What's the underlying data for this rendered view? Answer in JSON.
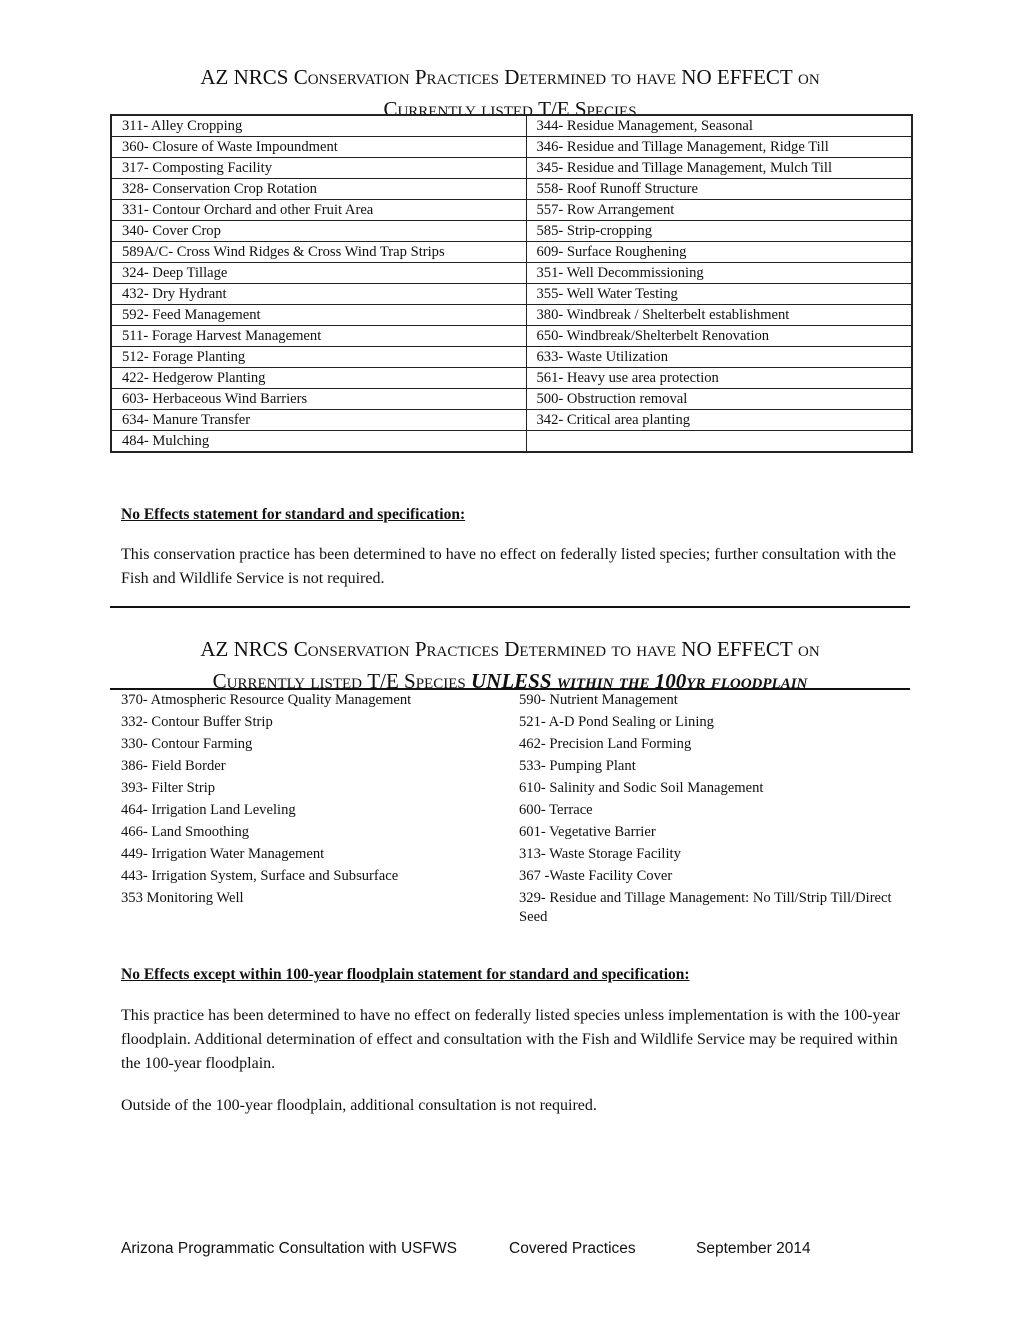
{
  "section1": {
    "title": {
      "prefix": "AZ NRCS ",
      "sc1": "Conservation Practices Determined to have ",
      "caps": "NO EFFECT",
      "sc2": " on",
      "line2_sc1": "Currently listed ",
      "line2_plain": "T/E ",
      "line2_sc2": "Species"
    },
    "rows": [
      [
        "311- Alley Cropping",
        "344- Residue Management, Seasonal"
      ],
      [
        "360- Closure of Waste Impoundment",
        "346- Residue and Tillage Management, Ridge Till"
      ],
      [
        "317- Composting Facility",
        "345- Residue and Tillage Management, Mulch Till"
      ],
      [
        "328- Conservation Crop Rotation",
        "558- Roof Runoff Structure"
      ],
      [
        "331- Contour Orchard and other Fruit Area",
        "557- Row Arrangement"
      ],
      [
        "340- Cover Crop",
        "585- Strip-cropping"
      ],
      [
        "589A/C- Cross Wind Ridges & Cross Wind Trap Strips",
        "609- Surface Roughening"
      ],
      [
        "324- Deep Tillage",
        "351- Well Decommissioning"
      ],
      [
        "432- Dry Hydrant",
        "355- Well Water Testing"
      ],
      [
        "592- Feed Management",
        "380- Windbreak / Shelterbelt establishment"
      ],
      [
        "511- Forage Harvest Management",
        "650- Windbreak/Shelterbelt Renovation"
      ],
      [
        "512- Forage Planting",
        "633- Waste Utilization"
      ],
      [
        "422- Hedgerow Planting",
        "561- Heavy use area protection"
      ],
      [
        "603- Herbaceous Wind Barriers",
        "500- Obstruction removal"
      ],
      [
        "634- Manure Transfer",
        "342- Critical area planting"
      ],
      [
        "484- Mulching",
        ""
      ]
    ],
    "statement_heading": "No Effects statement for standard and specification:",
    "statement_body": "This conservation practice has been determined to have no effect on federally listed species; further consultation with the Fish and Wildlife Service is not required."
  },
  "section2": {
    "title": {
      "prefix": "AZ NRCS ",
      "sc1": "Conservation Practices Determined to have ",
      "caps": "NO EFFECT",
      "sc2": " on",
      "line2_sc1": "Currently listed ",
      "line2_plain": "T/E ",
      "line2_sc2": "Species ",
      "unless": "UNLESS",
      "within": " within the ",
      "hundred": "100",
      "floodplain": "yr floodplain"
    },
    "rows": [
      [
        "370- Atmospheric Resource Quality Management",
        "590- Nutrient Management"
      ],
      [
        "332- Contour Buffer Strip",
        "521- A-D Pond Sealing or Lining"
      ],
      [
        "330- Contour Farming",
        "462- Precision Land Forming"
      ],
      [
        "386- Field Border",
        "533- Pumping Plant"
      ],
      [
        "393- Filter Strip",
        "610- Salinity and Sodic Soil Management"
      ],
      [
        "464- Irrigation Land Leveling",
        "600- Terrace"
      ],
      [
        "466- Land Smoothing",
        "601- Vegetative Barrier"
      ],
      [
        "449- Irrigation Water Management",
        "313- Waste Storage Facility"
      ],
      [
        "443- Irrigation System, Surface and Subsurface",
        "367 -Waste Facility Cover"
      ],
      [
        "353 Monitoring Well",
        "329- Residue and Tillage Management: No Till/Strip Till/Direct Seed"
      ]
    ],
    "statement_heading": "No Effects except within 100-year floodplain statement for standard and specification:",
    "statement_body": "This practice has been determined to have no effect on federally listed species unless implementation is with the 100-year floodplain.  Additional determination of effect and consultation with the Fish and Wildlife Service may be required within the 100-year floodplain.",
    "statement_body2": "Outside of the 100-year floodplain, additional consultation is not required."
  },
  "footer": {
    "left": "Arizona Programmatic Consultation with USFWS",
    "center": "Covered Practices",
    "right": "September 2014"
  }
}
